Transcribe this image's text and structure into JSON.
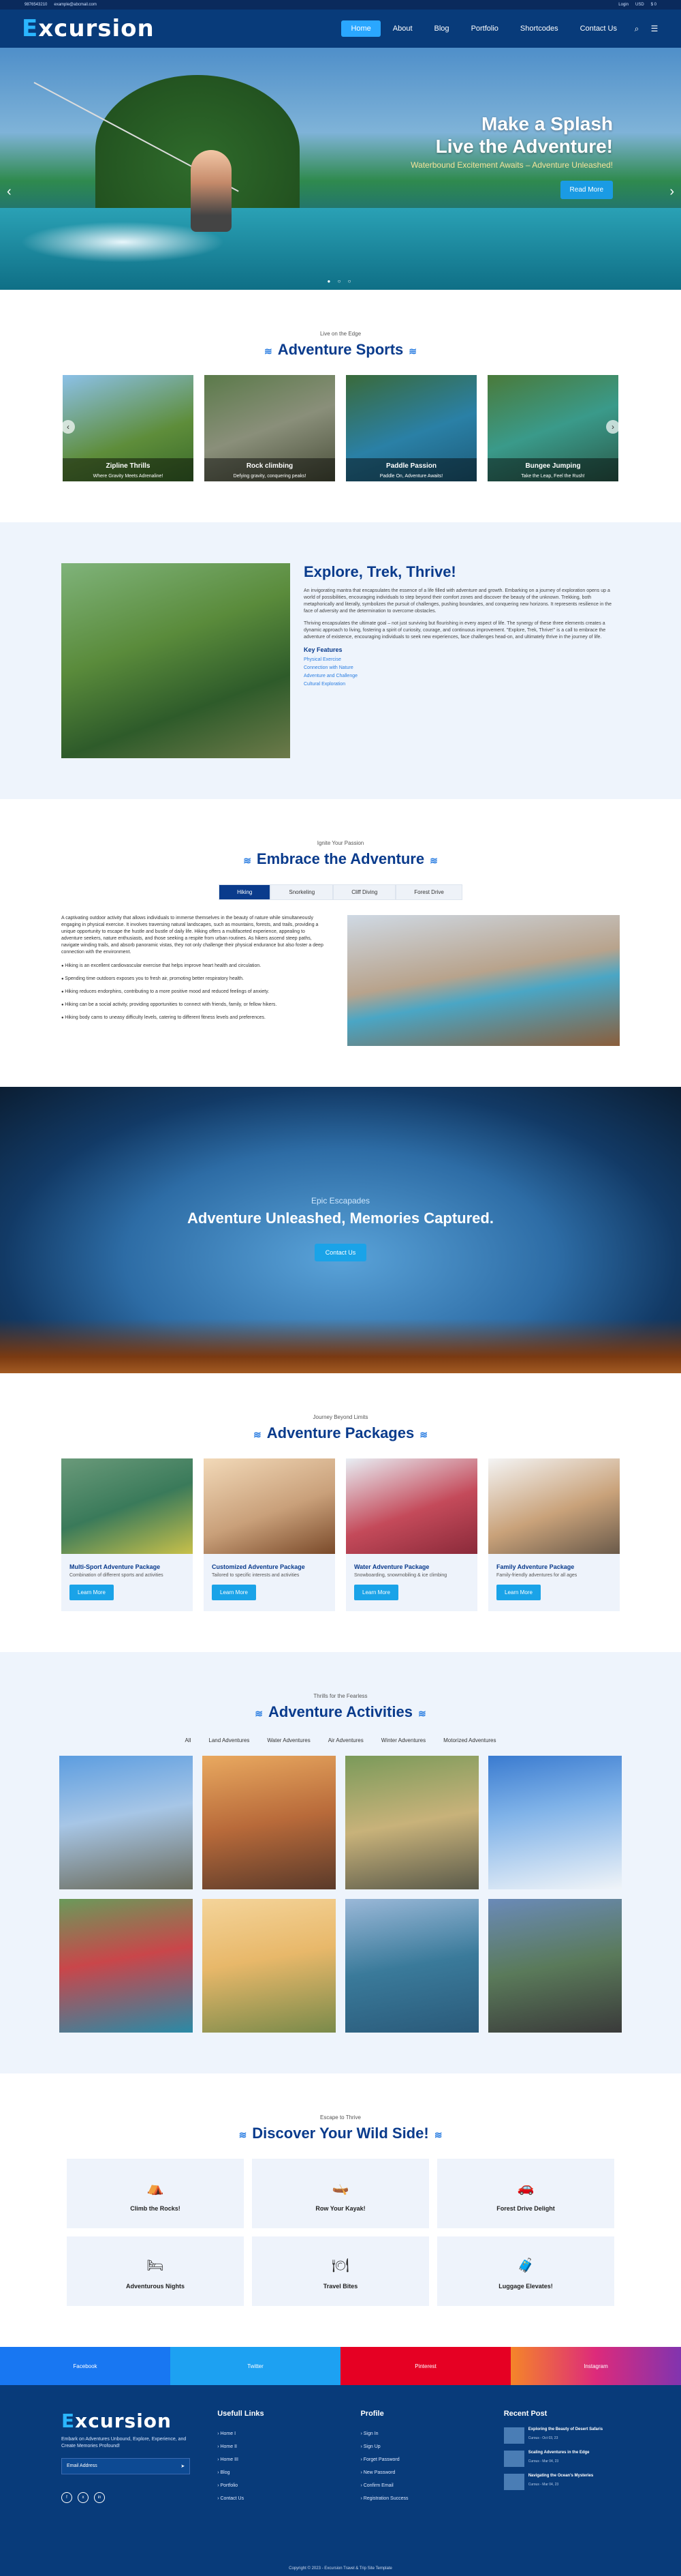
{
  "topbar": {
    "phone": "9876543210",
    "email": "example@abcmail.com",
    "login": "Login",
    "usd": "USD",
    "cart": "$ 0"
  },
  "brand": {
    "logo_e": "E",
    "logo_rest": "xcursion"
  },
  "nav": {
    "items": [
      "Home",
      "About",
      "Blog",
      "Portfolio",
      "Shortcodes",
      "Contact Us"
    ]
  },
  "hero": {
    "line1": "Make a Splash",
    "line2": "Live the Adventure!",
    "tagline": "Waterbound Excitement Awaits – Adventure Unleashed!",
    "button": "Read More"
  },
  "sports": {
    "sub": "Live on the Edge",
    "title": "Adventure Sports",
    "items": [
      {
        "title": "Zipline Thrills",
        "text": "Where Gravity Meets Adrenaline!"
      },
      {
        "title": "Rock climbing",
        "text": "Defying gravity, conquering peaks!"
      },
      {
        "title": "Paddle Passion",
        "text": "Paddle On, Adventure Awaits!"
      },
      {
        "title": "Bungee Jumping",
        "text": "Take the Leap, Feel the Rush!"
      }
    ]
  },
  "explore": {
    "title": "Explore, Trek, Thrive!",
    "p1": "An invigorating mantra that encapsulates the essence of a life filled with adventure and growth. Embarking on a journey of exploration opens up a world of possibilities, encouraging individuals to step beyond their comfort zones and discover the beauty of the unknown. Trekking, both metaphorically and literally, symbolizes the pursuit of challenges, pushing boundaries, and conquering new horizons. It represents resilience in the face of adversity and the determination to overcome obstacles.",
    "p2": "Thriving encapsulates the ultimate goal – not just surviving but flourishing in every aspect of life. The synergy of these three elements creates a dynamic approach to living, fostering a spirit of curiosity, courage, and continuous improvement. \"Explore, Trek, Thrive!\" is a call to embrace the adventure of existence, encouraging individuals to seek new experiences, face challenges head-on, and ultimately thrive in the journey of life.",
    "features_title": "Key Features",
    "features": [
      "Physical Exercise",
      "Connection with Nature",
      "Adventure and Challenge",
      "Cultural Exploration"
    ]
  },
  "embrace": {
    "sub": "Ignite Your Passion",
    "title": "Embrace the Adventure",
    "tabs": [
      "Hiking",
      "Snorkeling",
      "Cliff Diving",
      "Forest Drive"
    ],
    "intro": "A captivating outdoor activity that allows individuals to immerse themselves in the beauty of nature while simultaneously engaging in physical exercise. It involves traversing natural landscapes, such as mountains, forests, and trails, providing a unique opportunity to escape the hustle and bustle of daily life. Hiking offers a multifaceted experience, appealing to adventure seekers, nature enthusiasts, and those seeking a respite from urban routines. As hikers ascend steep paths, navigate winding trails, and absorb panoramic vistas, they not only challenge their physical endurance but also foster a deep connection with the environment.",
    "bullets": [
      "Hiking is an excellent cardiovascular exercise that helps improve heart health and circulation.",
      "Spending time outdoors exposes you to fresh air, promoting better respiratory health.",
      "Hiking reduces endorphins, contributing to a more positive mood and reduced feelings of anxiety.",
      "Hiking can be a social activity, providing opportunities to connect with friends, family, or fellow hikers.",
      "Hiking body cams to uneasy difficulty levels, catering to different fitness levels and preferences."
    ]
  },
  "cave": {
    "small": "Epic Escapades",
    "title": "Adventure Unleashed, Memories Captured.",
    "button": "Contact Us"
  },
  "packages": {
    "sub": "Journey Beyond Limits",
    "title": "Adventure Packages",
    "items": [
      {
        "title": "Multi-Sport Adventure Package",
        "text": "Combination of different sports and activities",
        "button": "Learn More"
      },
      {
        "title": "Customized Adventure Package",
        "text": "Tailored to specific interests and activities",
        "button": "Learn More"
      },
      {
        "title": "Water Adventure Package",
        "text": "Snowboarding, snowmobiling & ice climbing",
        "button": "Learn More"
      },
      {
        "title": "Family Adventure Package",
        "text": "Family-friendly adventures for all ages",
        "button": "Learn More"
      }
    ]
  },
  "activities": {
    "sub": "Thrills for the Fearless",
    "title": "Adventure Activities",
    "filters": [
      "All",
      "Land Adventures",
      "Water Adventures",
      "Air Adventures",
      "Winter Adventures",
      "Motorized Adventures"
    ]
  },
  "wild": {
    "sub": "Escape to Thrive",
    "title": "Discover Your Wild Side!",
    "items": [
      "Climb the Rocks!",
      "Row Your Kayak!",
      "Forest Drive Delight",
      "Adventurous Nights",
      "Travel Bites",
      "Luggage Elevates!"
    ]
  },
  "social": [
    "Facebook",
    "Twitter",
    "Pinterest",
    "Instagram"
  ],
  "footer": {
    "desc": "Embark on Adventures Unbound, Explore, Experience, and Create Memories Profound!",
    "email_ph": "Email Address",
    "useful_title": "Usefull Links",
    "useful": [
      "Home I",
      "Home II",
      "Home III",
      "Blog",
      "Portfolio",
      "Contact Us"
    ],
    "profile_title": "Profile",
    "profile": [
      "Sign In",
      "Sign Up",
      "Forget Password",
      "New Password",
      "Confirm Email",
      "Registration Success"
    ],
    "recent_title": "Recent Post",
    "recent": [
      {
        "title": "Exploring the Beauty of Desert Safaris",
        "meta": "Curous - Oct 03, 23"
      },
      {
        "title": "Scaling Adventures in the Edge",
        "meta": "Curous - Mar 04, 23"
      },
      {
        "title": "Navigating the Ocean's Mysteries",
        "meta": "Curous - Mar 04, 23"
      }
    ],
    "copyright": "Copyright © 2023 - Excursion Travel & Trip Site Template"
  },
  "colors": {
    "primary": "#083b7a",
    "accent": "#1aa3e8",
    "heading": "#0a3b8c"
  }
}
